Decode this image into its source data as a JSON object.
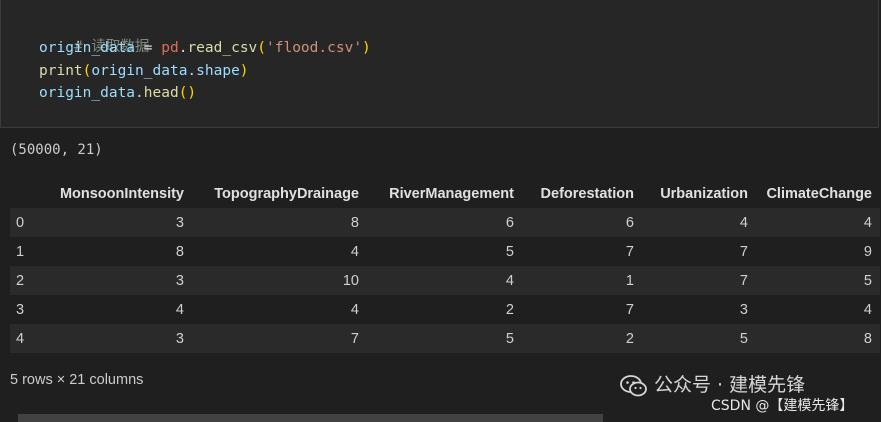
{
  "code": {
    "comment": "# 读取数据",
    "line2": {
      "var": "origin_data",
      "op": " = ",
      "mod": "pd",
      "dot": ".",
      "func": "read_csv",
      "open": "(",
      "arg": "'flood.csv'",
      "close": ")"
    },
    "line3": {
      "func": "print",
      "open": "(",
      "arg": "origin_data.shape",
      "close": ")"
    },
    "line4": {
      "var": "origin_data",
      "dot": ".",
      "func": "head",
      "parens": "()"
    }
  },
  "output": {
    "shape": "(50000, 21)",
    "table": {
      "columns": [
        "",
        "MonsoonIntensity",
        "TopographyDrainage",
        "RiverManagement",
        "Deforestation",
        "Urbanization",
        "ClimateChange"
      ],
      "rows": [
        [
          "0",
          "3",
          "8",
          "6",
          "6",
          "4",
          "4"
        ],
        [
          "1",
          "8",
          "4",
          "5",
          "7",
          "7",
          "9"
        ],
        [
          "2",
          "3",
          "10",
          "4",
          "1",
          "7",
          "5"
        ],
        [
          "3",
          "4",
          "4",
          "2",
          "7",
          "3",
          "4"
        ],
        [
          "4",
          "3",
          "7",
          "5",
          "2",
          "5",
          "8"
        ]
      ]
    },
    "summary": "5 rows × 21 columns"
  },
  "watermark": {
    "line1": "公众号 · 建模先锋",
    "line2": "CSDN @【建模先锋】"
  }
}
